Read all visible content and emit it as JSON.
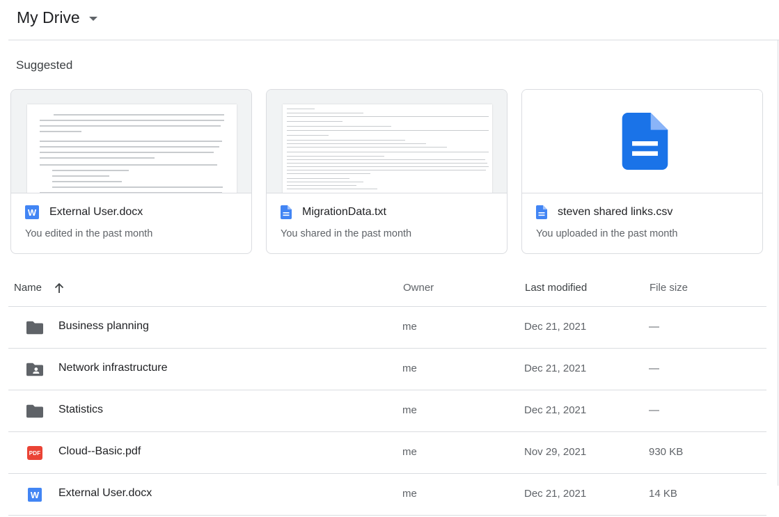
{
  "header": {
    "title": "My Drive"
  },
  "suggested": {
    "label": "Suggested",
    "cards": [
      {
        "name": "External User.docx",
        "subtitle": "You edited in the past month",
        "icon": "word-icon"
      },
      {
        "name": "MigrationData.txt",
        "subtitle": "You shared in the past month",
        "icon": "text-doc-icon"
      },
      {
        "name": "steven shared links.csv",
        "subtitle": "You uploaded in the past month",
        "icon": "text-doc-icon"
      }
    ]
  },
  "columns": {
    "name": "Name",
    "owner": "Owner",
    "modified": "Last modified",
    "size": "File size"
  },
  "files": [
    {
      "name": "Business planning",
      "owner": "me",
      "modified": "Dec 21, 2021",
      "size": "—",
      "icon": "folder-icon"
    },
    {
      "name": "Network infrastructure",
      "owner": "me",
      "modified": "Dec 21, 2021",
      "size": "—",
      "icon": "shared-folder-icon"
    },
    {
      "name": "Statistics",
      "owner": "me",
      "modified": "Dec 21, 2021",
      "size": "—",
      "icon": "folder-icon"
    },
    {
      "name": "Cloud--Basic.pdf",
      "owner": "me",
      "modified": "Nov 29, 2021",
      "size": "930 KB",
      "icon": "pdf-icon"
    },
    {
      "name": "External User.docx",
      "owner": "me",
      "modified": "Dec 21, 2021",
      "size": "14 KB",
      "icon": "word-icon"
    }
  ],
  "colors": {
    "accent": "#1a73e8",
    "word": "#4285f4",
    "pdf": "#ea4335",
    "folder": "#5f6368"
  }
}
